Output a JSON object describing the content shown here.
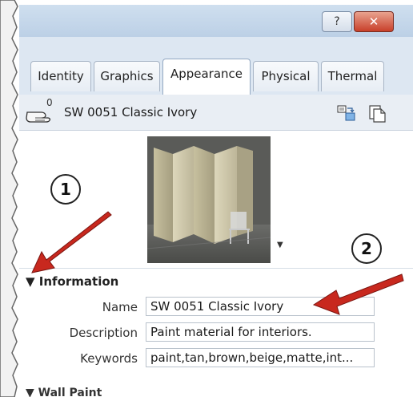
{
  "window": {
    "help_label": "?",
    "close_label": "✕"
  },
  "tabs": [
    {
      "label": "Identity",
      "active": false
    },
    {
      "label": "Graphics",
      "active": false
    },
    {
      "label": "Appearance",
      "active": true
    },
    {
      "label": "Physical",
      "active": false
    },
    {
      "label": "Thermal",
      "active": false
    }
  ],
  "asset": {
    "usage_count": "0",
    "name": "SW 0051 Classic Ivory"
  },
  "icons": {
    "hand": "hand-icon",
    "duplicate": "duplicate-asset-icon",
    "copy": "copy-asset-icon",
    "preview_menu": "chevron-down-icon"
  },
  "information": {
    "section_label": "Information",
    "name_label": "Name",
    "name_value": "SW 0051 Classic Ivory",
    "description_label": "Description",
    "description_value": "Paint material for interiors.",
    "keywords_label": "Keywords",
    "keywords_value": "paint,tan,brown,beige,matte,int..."
  },
  "next_section": {
    "label": "Wall Paint"
  },
  "callouts": [
    {
      "number": "1"
    },
    {
      "number": "2"
    }
  ],
  "colors": {
    "callout_arrow": "#c8281e",
    "active_tab_border": "#93a8c2",
    "close_button": "#c8402a"
  }
}
